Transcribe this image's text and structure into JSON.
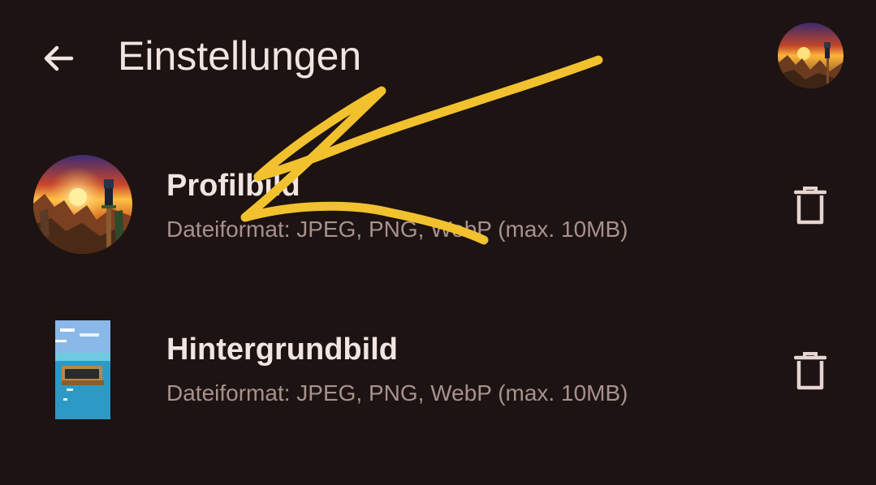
{
  "header": {
    "title": "Einstellungen",
    "back_icon": "arrow-back-icon",
    "avatar_icon": "account-avatar"
  },
  "settings": [
    {
      "title": "Profilbild",
      "subtitle": "Dateiformat: JPEG, PNG, WebP (max. 10MB)",
      "thumbnail": "round-profile-picture",
      "action_icon": "trash-icon"
    },
    {
      "title": "Hintergrundbild",
      "subtitle": "Dateiformat: JPEG, PNG, WebP (max. 10MB)",
      "thumbnail": "background-picture",
      "action_icon": "trash-icon"
    }
  ],
  "colors": {
    "background": "#1c1312",
    "text_primary": "#f2e4e1",
    "text_secondary": "#a8918c",
    "annotation": "#f2c12e"
  }
}
